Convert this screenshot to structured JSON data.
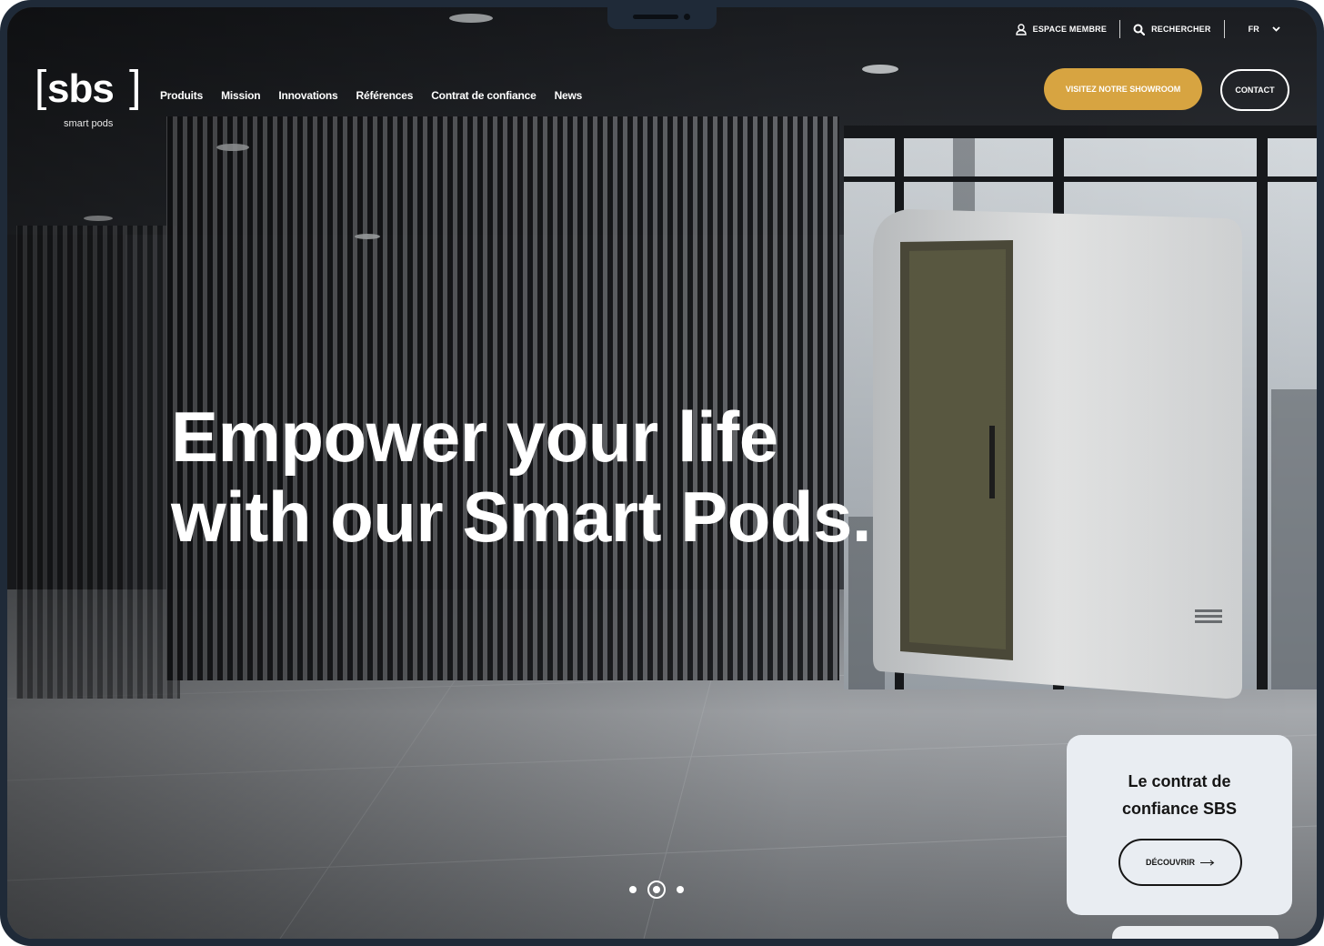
{
  "utility": {
    "member_label": "ESPACE MEMBRE",
    "search_label": "RECHERCHER",
    "language": "FR"
  },
  "logo": {
    "word": "sbs",
    "subtitle": "smart pods"
  },
  "nav": {
    "items": [
      "Produits",
      "Mission",
      "Innovations",
      "Références",
      "Contrat de confiance",
      "News"
    ]
  },
  "actions": {
    "showroom_label": "VISITEZ NOTRE SHOWROOM",
    "contact_label": "CONTACT"
  },
  "hero": {
    "line1": "Empower your life",
    "line2": "with our Smart Pods."
  },
  "card": {
    "title_line1": "Le contrat de",
    "title_line2": "confiance SBS",
    "button_label": "DÉCOUVRIR"
  },
  "slider": {
    "count": 3,
    "active": 2
  },
  "colors": {
    "accent": "#d7a441",
    "frame": "#1f2a38",
    "card_bg": "#e9edf2"
  },
  "icons": [
    "user-icon",
    "search-icon",
    "chevron-down-icon",
    "arrow-right-icon"
  ]
}
